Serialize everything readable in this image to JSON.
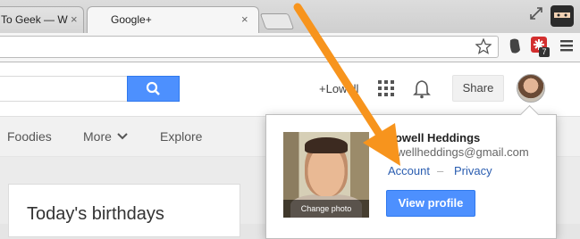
{
  "browser": {
    "tabs": [
      {
        "title": "To Geek — W",
        "active": false
      },
      {
        "title": "Google+",
        "active": true
      }
    ],
    "tab_close_glyph": "×",
    "favicon_gplus_text": "g+",
    "extension_badge": "7"
  },
  "header": {
    "user_link": "+Lowell",
    "share_label": "Share"
  },
  "nav": {
    "items": [
      "Foodies",
      "More",
      "Explore"
    ]
  },
  "content": {
    "card_title": "Today's birthdays"
  },
  "account_popup": {
    "name": "Lowell Heddings",
    "email": "lowellheddings@gmail.com",
    "account_link": "Account",
    "separator": "–",
    "privacy_link": "Privacy",
    "change_photo": "Change photo",
    "view_profile": "View profile"
  },
  "colors": {
    "accent_blue": "#4d90fe",
    "gplus_red": "#dd4b39",
    "arrow_orange": "#f7941d"
  }
}
